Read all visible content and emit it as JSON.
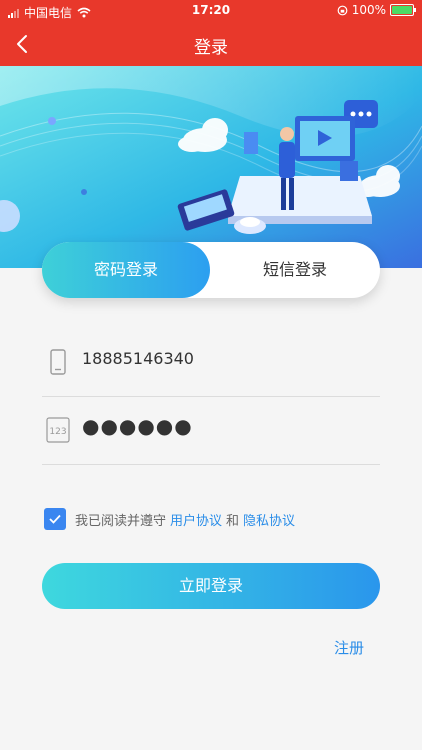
{
  "status_bar": {
    "carrier": "中国电信",
    "time": "17:20",
    "battery": "100%",
    "battery_level": 1.0
  },
  "nav": {
    "title": "登录",
    "back_icon": "chevron-left-icon"
  },
  "tabs": [
    {
      "label": "密码登录",
      "active": true
    },
    {
      "label": "短信登录",
      "active": false
    }
  ],
  "form": {
    "phone_value": "18885146340",
    "phone_icon": "phone-icon",
    "password_value": "●●●●●●",
    "password_icon": "number-keypad-icon"
  },
  "agreement": {
    "checked": true,
    "prefix": "我已阅读并遵守",
    "user_agreement": "用户协议",
    "and": "和",
    "privacy_agreement": "隐私协议"
  },
  "login_button": "立即登录",
  "register_link": "注册",
  "colors": {
    "header_red": "#e8382b",
    "accent_blue": "#2a8de8",
    "gradient_start": "#3ed8de",
    "gradient_end": "#2a96ec"
  }
}
